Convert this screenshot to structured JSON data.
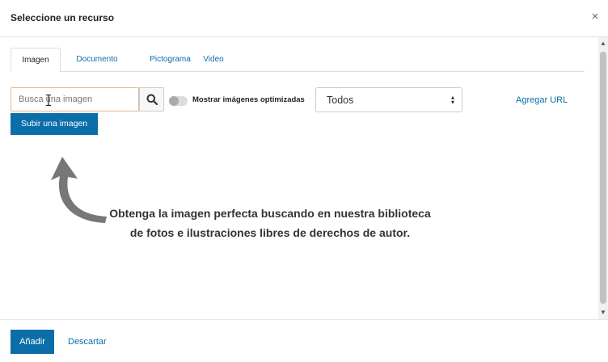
{
  "dialog": {
    "title": "Seleccione un recurso",
    "close_icon": "×"
  },
  "tabs": [
    {
      "label": "Imagen",
      "active": true
    },
    {
      "label": "Documento",
      "active": false
    },
    {
      "label": "Pictograma",
      "active": false
    },
    {
      "label": "Video",
      "active": false
    }
  ],
  "search": {
    "placeholder": "Busca una imagen",
    "value": ""
  },
  "optimized_toggle": {
    "label": "Mostrar imágenes optimizadas",
    "on": false
  },
  "filter_select": {
    "selected": "Todos",
    "caret": "▲▼"
  },
  "add_url_label": "Agregar URL",
  "upload_label": "Subir una imagen",
  "hint": {
    "text": "Obtenga la imagen perfecta buscando en nuestra biblioteca de fotos e ilustraciones libres de derechos de autor."
  },
  "footer": {
    "add_label": "Añadir",
    "discard_label": "Descartar"
  },
  "scrollbar": {
    "up_icon": "▲",
    "down_icon": "▼"
  },
  "colors": {
    "accent": "#0b6ea8",
    "search_border": "#e8b98a",
    "arrow": "#777777"
  },
  "icons": {
    "search": "magnifier-icon",
    "close": "close-icon",
    "arrow": "curved-arrow-up-icon",
    "cursor": "text-cursor-icon"
  }
}
